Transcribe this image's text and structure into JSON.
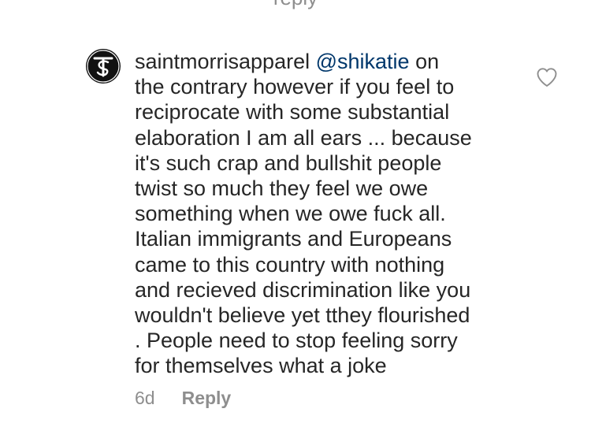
{
  "header": {
    "cut_off_text": "reply"
  },
  "comment": {
    "avatar_icon": "saint-morris-monogram-icon",
    "username": "saintmorrisapparel",
    "mention": "@shikatie",
    "lines": [
      " on",
      "the contrary however if you feel to",
      "reciprocate with some substantial",
      "elaboration I am all ears ... because",
      "it's such crap and bullshit people",
      "twist so much they feel we owe",
      "something when we owe fuck all.",
      "Italian immigrants and Europeans",
      "came to this country with nothing",
      "and recieved discrimination like you",
      "wouldn't believe yet tthey flourished",
      ". People need to stop feeling sorry",
      "for themselves what a joke"
    ],
    "age": "6d",
    "reply_label": "Reply",
    "like_icon": "heart-outline-icon"
  },
  "colors": {
    "text": "#262626",
    "mention": "#00376b",
    "secondary": "#8e8e8e",
    "avatar_bg": "#111111"
  }
}
